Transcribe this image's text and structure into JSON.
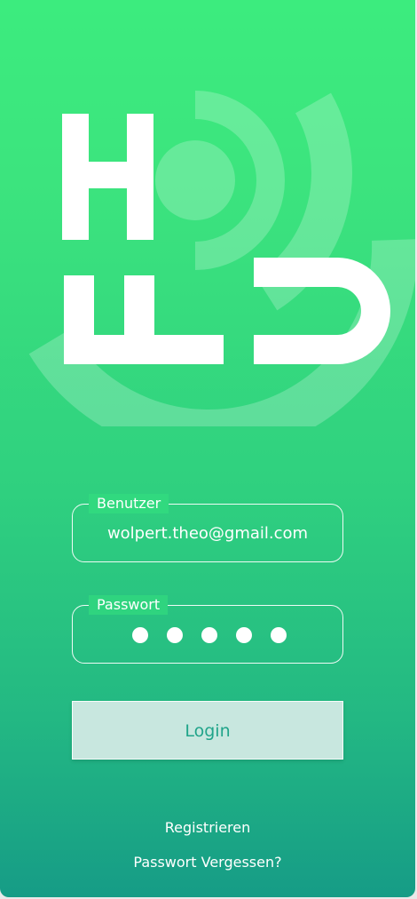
{
  "logo": {
    "letters": "HFU",
    "icon": "hfu-logo-icon"
  },
  "form": {
    "user": {
      "label": "Benutzer",
      "value": "wolpert.theo@gmail.com"
    },
    "password": {
      "label": "Passwort",
      "masked_length": 5
    },
    "login_label": "Login"
  },
  "links": {
    "register": "Registrieren",
    "forgot_password": "Passwort Vergessen?"
  },
  "colors": {
    "background_top": "#3cec7e",
    "background_bottom": "#169c86",
    "button_background": "#c8e7df",
    "button_text": "#20a48a"
  }
}
